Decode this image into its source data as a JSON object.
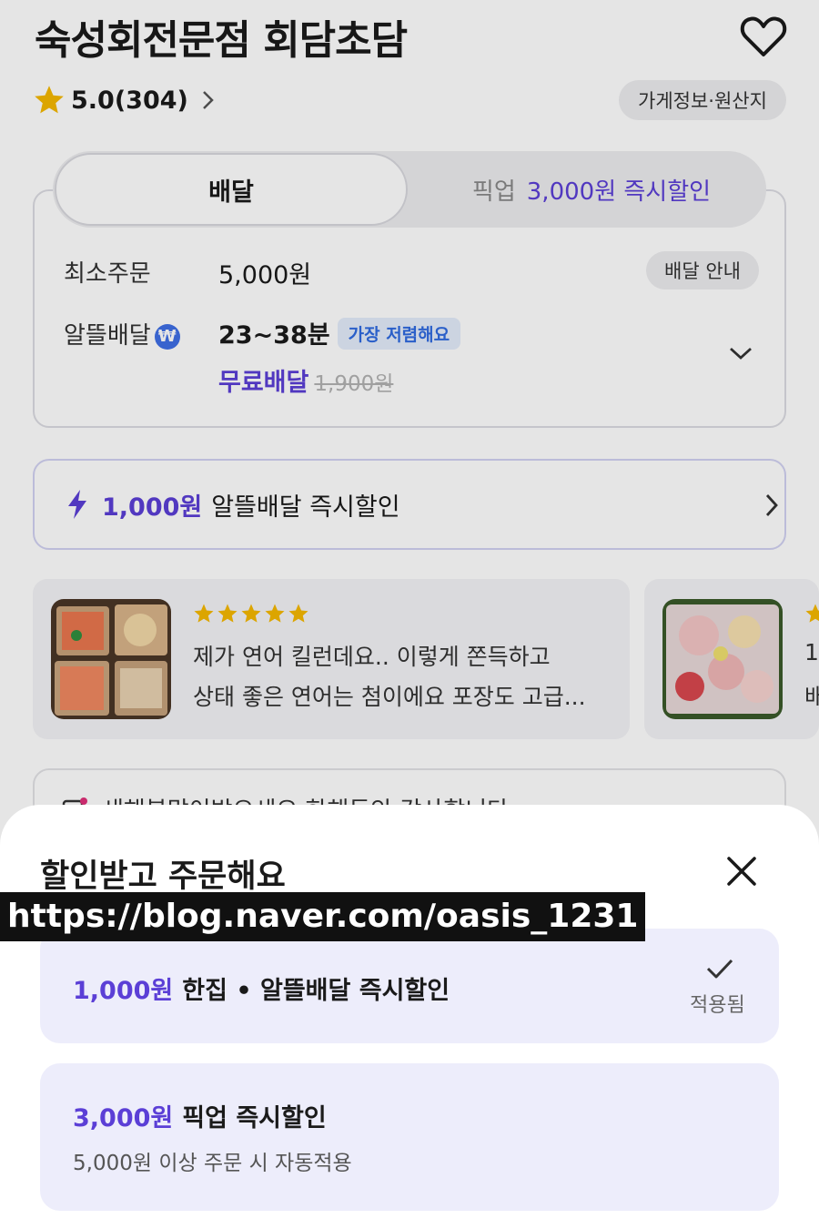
{
  "store": {
    "name": "숙성회전문점 회담초담",
    "rating": "5.0(304)",
    "info_chip": "가게정보·원산지"
  },
  "tabs": {
    "delivery": "배달",
    "pickup": "픽업",
    "pickup_promo": "3,000원 즉시할인"
  },
  "delivery_info": {
    "min_order_label": "최소주문",
    "min_order_value": "5,000원",
    "guide_chip": "배달 안내",
    "type_label": "알뜰배달",
    "time": "23~38분",
    "cheapest_badge": "가장 저렴해요",
    "free_label": "무료배달",
    "old_fee": "1,900원"
  },
  "instant_banner": {
    "amount": "1,000원",
    "text": "알뜰배달 즉시할인"
  },
  "reviews": [
    {
      "rating": 5,
      "line1": "제가 연어 킬런데요.. 이렇게 쫀득하고",
      "line2": "상태 좋은 연어는 첨이에요 포장도 고급..."
    },
    {
      "line1": "1",
      "line2": "배"
    }
  ],
  "peek_text": "새해복많이받으세요 한해동안 감사합니다",
  "sheet": {
    "title": "할인받고 주문해요",
    "watermark": "https://blog.naver.com/oasis_1231",
    "options": [
      {
        "amount": "1,000원",
        "label": "한집 • 알뜰배달 즉시할인",
        "status": "적용됨"
      },
      {
        "amount": "3,000원",
        "label": "픽업 즉시할인",
        "sub": "5,000원 이상 주문 시 자동적용"
      }
    ]
  },
  "colors": {
    "accent": "#5b3fd6",
    "star": "#f5b800",
    "badge_blue": "#2f6ae0",
    "option_bg": "#ededfb"
  },
  "icons": [
    "heart-icon",
    "star-icon",
    "chevron-right-icon",
    "chevron-down-icon",
    "lightning-icon",
    "close-icon",
    "check-icon"
  ]
}
